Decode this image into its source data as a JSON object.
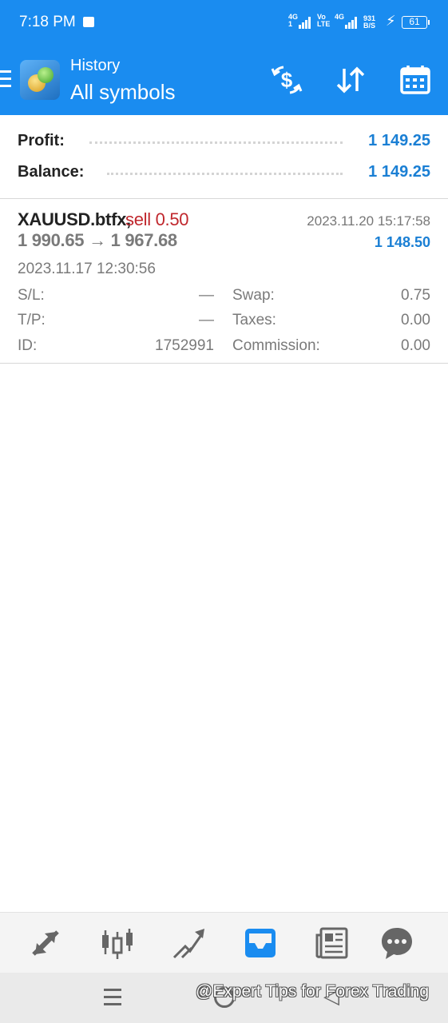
{
  "status_bar": {
    "time": "7:18 PM",
    "sim1_network": "4G",
    "sim1_sub": "1",
    "volte_top": "Vo",
    "volte_bottom": "LTE",
    "sim2_network": "4G",
    "speed_value": "931",
    "speed_unit": "B/S",
    "battery": "61"
  },
  "app_bar": {
    "subtitle": "History",
    "title": "All symbols",
    "actions": [
      "dollar-swap-icon",
      "sort-icon",
      "calendar-icon"
    ]
  },
  "summary": {
    "profit_label": "Profit:",
    "profit_value": "1 149.25",
    "balance_label": "Balance:",
    "balance_value": "1 149.25"
  },
  "deal": {
    "symbol": "XAUUSD.btfx,",
    "side": "sell 0.50",
    "close_time": "2023.11.20 15:17:58",
    "open_price": "1 990.65",
    "arrow": "→",
    "close_price": "1 967.68",
    "profit": "1 148.50",
    "open_time": "2023.11.17 12:30:56",
    "sl_label": "S/L:",
    "sl_value": "—",
    "tp_label": "T/P:",
    "tp_value": "—",
    "id_label": "ID:",
    "id_value": "1752991",
    "swap_label": "Swap:",
    "swap_value": "0.75",
    "taxes_label": "Taxes:",
    "taxes_value": "0.00",
    "commission_label": "Commission:",
    "commission_value": "0.00"
  },
  "bottom_nav": {
    "items": [
      "quotes-icon",
      "chart-icon",
      "trade-icon",
      "history-icon",
      "news-icon",
      "messages-icon"
    ],
    "active": "history-icon"
  },
  "watermark": "@Expert Tips for Forex Trading",
  "colors": {
    "primary": "#1a8cf0",
    "profit": "#1a7fd4",
    "sell": "#c0272d",
    "muted": "#7a7a7a"
  }
}
